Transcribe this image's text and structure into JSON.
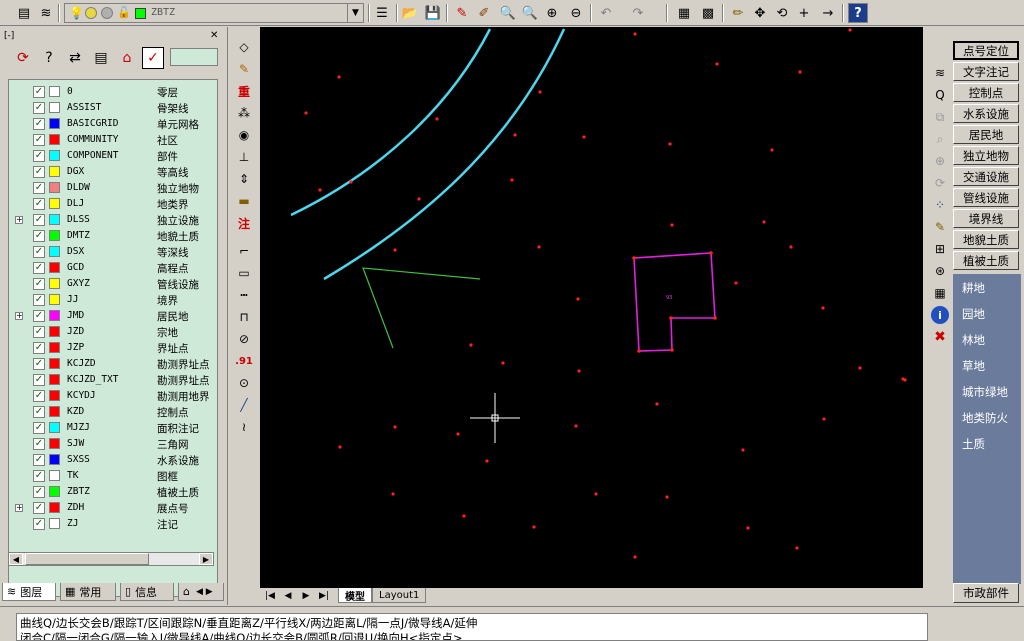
{
  "toolbar": {
    "layer_combo_value": "ZBTZ",
    "layer_combo_swatch": "#00ff00"
  },
  "left_panel": {
    "title": "[-]",
    "close": "✕",
    "tabs": [
      "图层",
      "常用",
      "信息"
    ]
  },
  "layers": [
    {
      "name": "0",
      "desc": "零层",
      "color": "#ffffff",
      "expand": false
    },
    {
      "name": "ASSIST",
      "desc": "骨架线",
      "color": "#ffffff",
      "expand": false
    },
    {
      "name": "BASICGRID",
      "desc": "单元网格",
      "color": "#0000ff",
      "expand": false
    },
    {
      "name": "COMMUNITY",
      "desc": "社区",
      "color": "#ff0000",
      "expand": false
    },
    {
      "name": "COMPONENT",
      "desc": "部件",
      "color": "#00ffff",
      "expand": false
    },
    {
      "name": "DGX",
      "desc": "等高线",
      "color": "#ffff00",
      "expand": false
    },
    {
      "name": "DLDW",
      "desc": "独立地物",
      "color": "#f08080",
      "expand": false
    },
    {
      "name": "DLJ",
      "desc": "地类界",
      "color": "#ffff00",
      "expand": false
    },
    {
      "name": "DLSS",
      "desc": "独立设施",
      "color": "#00ffff",
      "expand": true
    },
    {
      "name": "DMTZ",
      "desc": "地貌土质",
      "color": "#00ff00",
      "expand": false
    },
    {
      "name": "DSX",
      "desc": "等深线",
      "color": "#00ffff",
      "expand": false
    },
    {
      "name": "GCD",
      "desc": "高程点",
      "color": "#ff0000",
      "expand": false
    },
    {
      "name": "GXYZ",
      "desc": "管线设施",
      "color": "#ffff00",
      "expand": false
    },
    {
      "name": "JJ",
      "desc": "境界",
      "color": "#ffff00",
      "expand": false
    },
    {
      "name": "JMD",
      "desc": "居民地",
      "color": "#ff00ff",
      "expand": true
    },
    {
      "name": "JZD",
      "desc": "宗地",
      "color": "#ff0000",
      "expand": false
    },
    {
      "name": "JZP",
      "desc": "界址点",
      "color": "#ff0000",
      "expand": false
    },
    {
      "name": "KCJZD",
      "desc": "勘测界址点",
      "color": "#ff0000",
      "expand": false
    },
    {
      "name": "KCJZD_TXT",
      "desc": "勘测界址点",
      "color": "#ff0000",
      "expand": false
    },
    {
      "name": "KCYDJ",
      "desc": "勘测用地界",
      "color": "#ff0000",
      "expand": false
    },
    {
      "name": "KZD",
      "desc": "控制点",
      "color": "#ff0000",
      "expand": false
    },
    {
      "name": "MJZJ",
      "desc": "面积注记",
      "color": "#00ffff",
      "expand": false
    },
    {
      "name": "SJW",
      "desc": "三角网",
      "color": "#ff0000",
      "expand": false
    },
    {
      "name": "SXSS",
      "desc": "水系设施",
      "color": "#0000ff",
      "expand": false
    },
    {
      "name": "TK",
      "desc": "图框",
      "color": "#ffffff",
      "expand": false
    },
    {
      "name": "ZBTZ",
      "desc": "植被土质",
      "color": "#00ff00",
      "expand": false
    },
    {
      "name": "ZDH",
      "desc": "展点号",
      "color": "#ff0000",
      "expand": true
    },
    {
      "name": "ZJ",
      "desc": "注记",
      "color": "#ffffff",
      "expand": false
    }
  ],
  "right_panel": {
    "buttons": [
      "点号定位",
      "文字注记",
      "控制点",
      "水系设施",
      "居民地",
      "独立地物",
      "交通设施",
      "管线设施",
      "境界线",
      "地貌土质",
      "植被土质"
    ],
    "selected": "点号定位",
    "sub_items": [
      "耕地",
      "园地",
      "林地",
      "草地",
      "城市绿地",
      "地类防火",
      "土质"
    ],
    "bottom": "市政部件"
  },
  "canvas": {
    "tabs": [
      "模型",
      "Layout1"
    ],
    "active_tab": "模型",
    "polygon_label": "93"
  },
  "command": {
    "line1": "曲线Q/边长交会B/跟踪T/区间跟踪N/垂直距离Z/平行线X/两边距离L/隔一点J/微导线A/延伸",
    "line2": "闭合C/隔一闭合G/隔一输入J/微导线A/曲线Q/边长交会B/圆弧R/回退U/换向H<指定点>"
  },
  "colors": {
    "canvas_bg": "#000000",
    "curve": "#4fd5ec",
    "point": "#ff2020",
    "polygon": "#e020e0",
    "line": "#40c040",
    "panel_green": "#cfe9d8",
    "sub_panel": "#6b7b9b"
  }
}
